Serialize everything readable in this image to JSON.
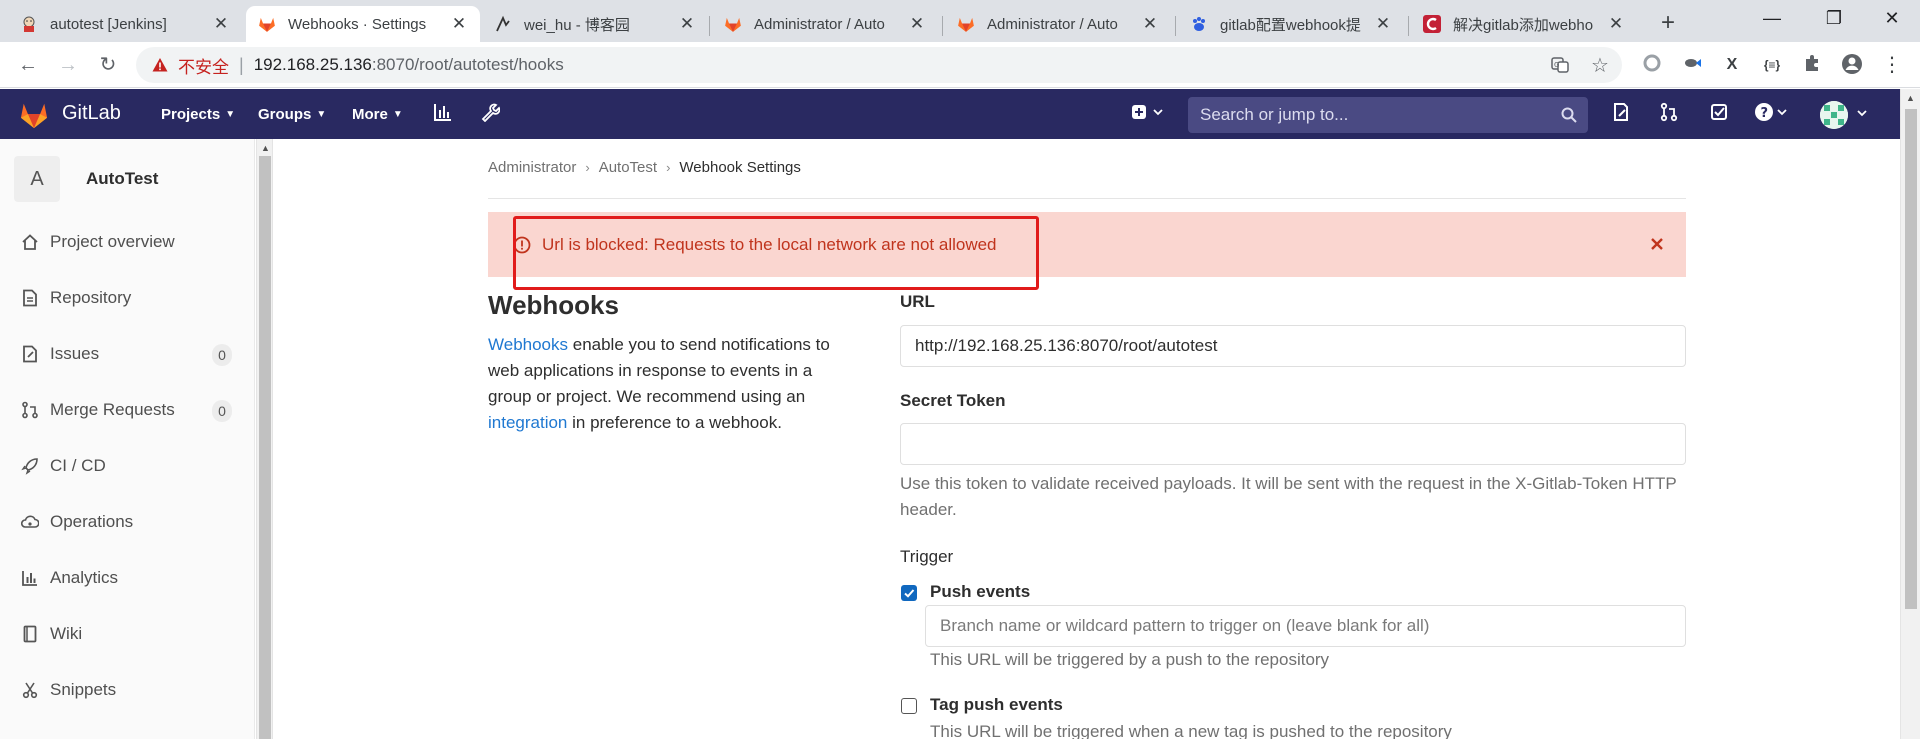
{
  "browser": {
    "tabs": [
      {
        "title": "autotest [Jenkins]",
        "icon": "jenkins-icon"
      },
      {
        "title": "Webhooks · Settings",
        "icon": "gitlab-icon"
      },
      {
        "title": "wei_hu - 博客园",
        "icon": "cnblogs-icon"
      },
      {
        "title": "Administrator / Auto",
        "icon": "gitlab-icon"
      },
      {
        "title": "Administrator / Auto",
        "icon": "gitlab-icon"
      },
      {
        "title": "gitlab配置webhook提",
        "icon": "baidu-icon"
      },
      {
        "title": "解决gitlab添加webho",
        "icon": "csdn-icon"
      }
    ],
    "address": {
      "insecure_label": "不安全",
      "url_host": "192.168.25.136",
      "url_rest": ":8070/root/autotest/hooks"
    }
  },
  "gitlab": {
    "brand": "GitLab",
    "nav": {
      "projects": "Projects",
      "groups": "Groups",
      "more": "More"
    },
    "search_placeholder": "Search or jump to...",
    "colors": {
      "header": "#292961",
      "accent": "#1068bf",
      "alert_bg": "#fad6d0",
      "alert_text": "#c0341d"
    }
  },
  "sidebar": {
    "project_avatar": "A",
    "project_name": "AutoTest",
    "items": [
      {
        "label": "Project overview",
        "icon": "home-icon"
      },
      {
        "label": "Repository",
        "icon": "document-icon"
      },
      {
        "label": "Issues",
        "icon": "issues-icon",
        "badge": "0"
      },
      {
        "label": "Merge Requests",
        "icon": "merge-request-icon",
        "badge": "0"
      },
      {
        "label": "CI / CD",
        "icon": "rocket-icon"
      },
      {
        "label": "Operations",
        "icon": "cloud-gear-icon"
      },
      {
        "label": "Analytics",
        "icon": "chart-icon"
      },
      {
        "label": "Wiki",
        "icon": "book-icon"
      },
      {
        "label": "Snippets",
        "icon": "snippet-icon"
      }
    ]
  },
  "breadcrumb": {
    "items": [
      "Administrator",
      "AutoTest",
      "Webhook Settings"
    ]
  },
  "alert": {
    "message": "Url is blocked: Requests to the local network are not allowed"
  },
  "webhooks": {
    "title": "Webhooks",
    "desc_link": "Webhooks",
    "desc_text_1": " enable you to send notifications to web applications in response to events in a group or project. We recommend using an ",
    "desc_link_2": "integration",
    "desc_text_2": " in preference to a webhook."
  },
  "form": {
    "url_label": "URL",
    "url_value": "http://192.168.25.136:8070/root/autotest",
    "token_label": "Secret Token",
    "token_value": "",
    "token_help": "Use this token to validate received payloads. It will be sent with the request in the X-Gitlab-Token HTTP header.",
    "trigger_label": "Trigger",
    "push_label": "Push events",
    "push_checked": true,
    "branch_placeholder": "Branch name or wildcard pattern to trigger on (leave blank for all)",
    "push_help": "This URL will be triggered by a push to the repository",
    "tag_label": "Tag push events",
    "tag_checked": false,
    "tag_help": "This URL will be triggered when a new tag is pushed to the repository"
  }
}
